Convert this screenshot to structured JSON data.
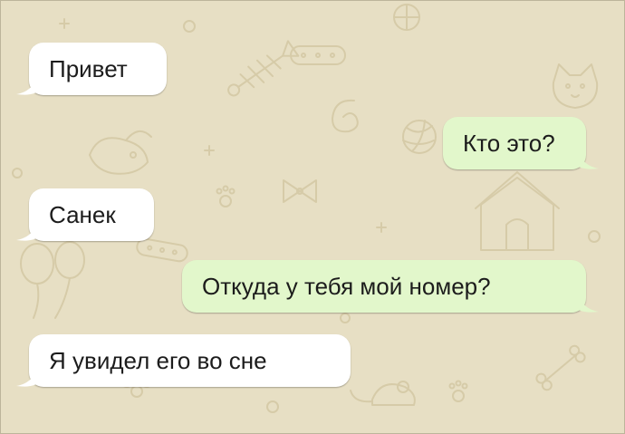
{
  "colors": {
    "wallpaper": "#e7dfc4",
    "wallpaper_doodles": "#d9cfae",
    "incoming_bubble": "#ffffff",
    "outgoing_bubble": "#e2f7cb",
    "text": "#1c1c1c"
  },
  "messages": [
    {
      "direction": "incoming",
      "text": "Привет"
    },
    {
      "direction": "outgoing",
      "text": "Кто это?"
    },
    {
      "direction": "incoming",
      "text": "Санек"
    },
    {
      "direction": "outgoing",
      "text": "Откуда у тебя мой номер?"
    },
    {
      "direction": "incoming",
      "text": "Я увидел его во сне"
    }
  ]
}
